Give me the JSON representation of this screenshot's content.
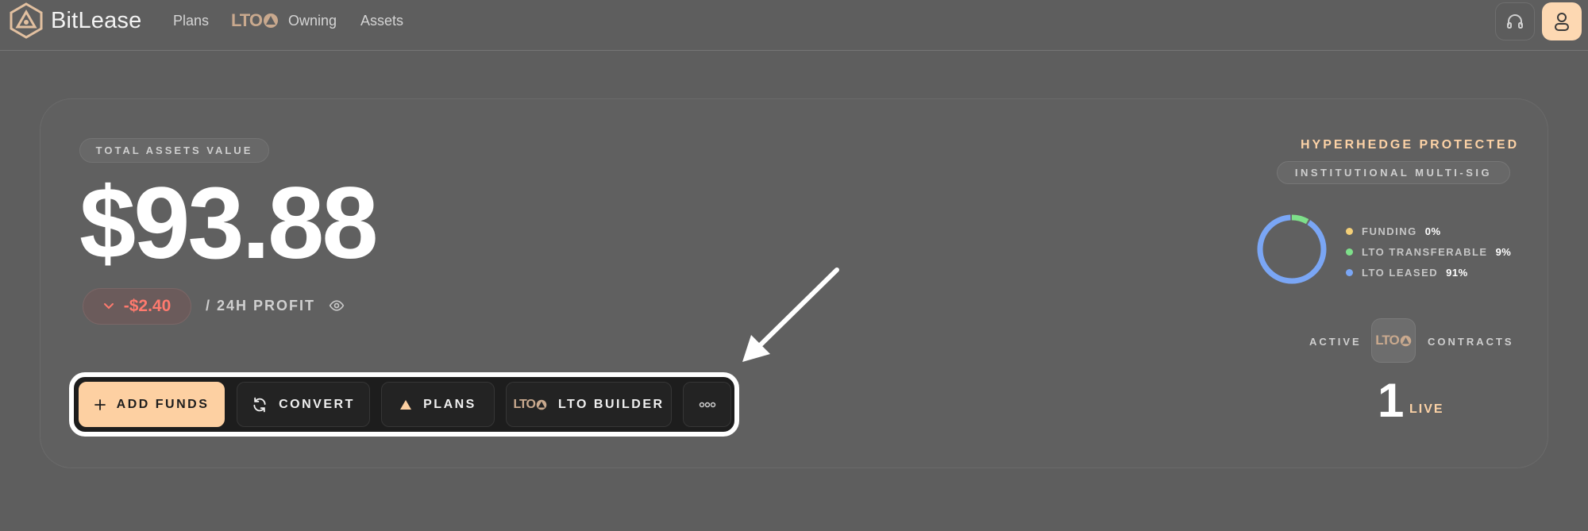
{
  "nav": {
    "brand": "BitLease",
    "items": [
      {
        "label": "Plans"
      },
      {
        "label": "LTO"
      },
      {
        "label": "Owning"
      },
      {
        "label": "Assets"
      }
    ]
  },
  "portfolio": {
    "label": "TOTAL ASSETS VALUE",
    "value": "$93.88",
    "delta": "-$2.40",
    "delta_label": "/ 24H PROFIT"
  },
  "actions": {
    "add_funds": "ADD FUNDS",
    "convert": "CONVERT",
    "plans": "PLANS",
    "lto_builder": "LTO BUILDER"
  },
  "protection": {
    "title": "HYPERHEDGE PROTECTED",
    "badge": "INSTITUTIONAL MULTI-SIG"
  },
  "allocation": [
    {
      "label": "FUNDING",
      "pct": "0%",
      "value": 0,
      "color": "#f3cf77"
    },
    {
      "label": "LTO TRANSFERABLE",
      "pct": "9%",
      "value": 9,
      "color": "#7ee08a"
    },
    {
      "label": "LTO LEASED",
      "pct": "91%",
      "value": 91,
      "color": "#7aa6f5"
    }
  ],
  "contracts": {
    "active_label": "ACTIVE",
    "contracts_label": "CONTRACTS",
    "lto_mark": "LTO",
    "count": "1",
    "status": "LIVE"
  },
  "colors": {
    "accent": "#fdd0a2",
    "negative": "#ff7a6e",
    "gold": "#c9a98e"
  }
}
